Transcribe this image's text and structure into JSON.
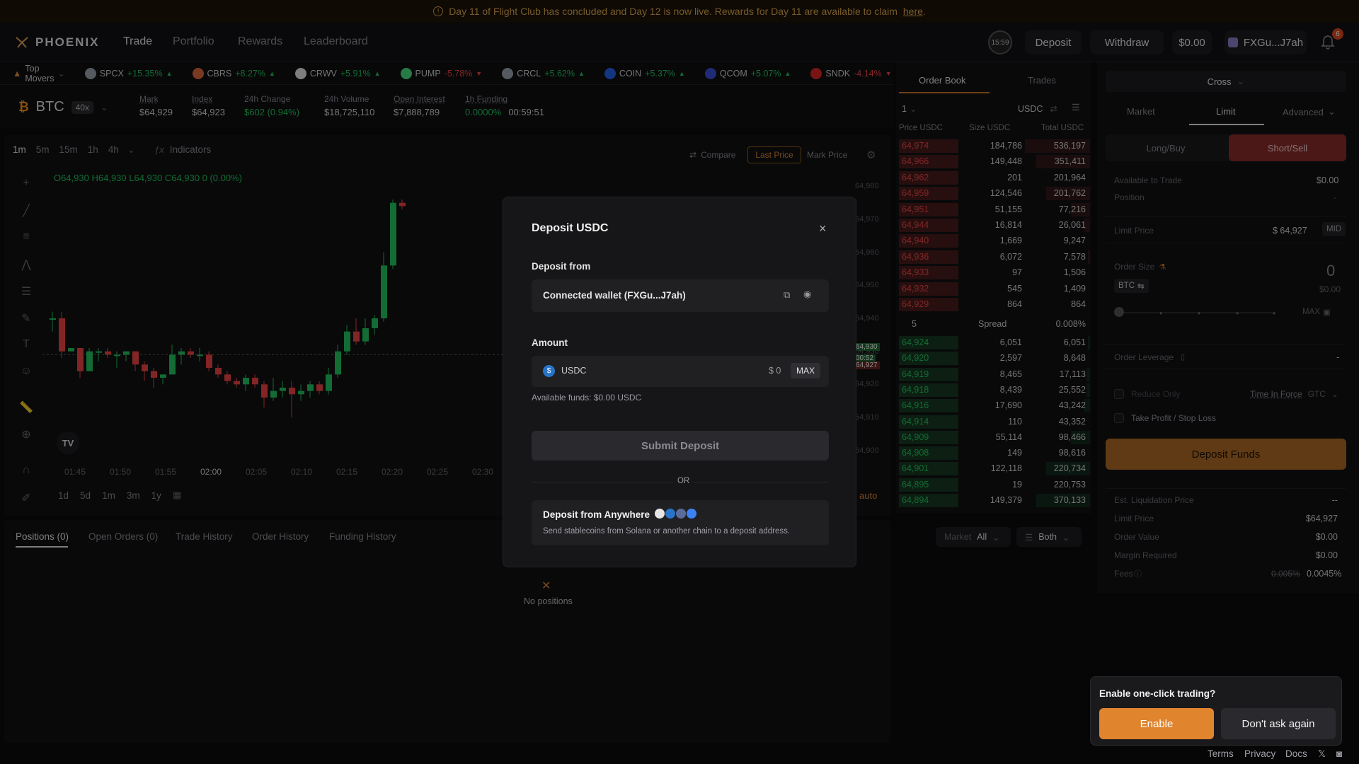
{
  "banner": {
    "text": "Day 11 of Flight Club has concluded and Day 12 is now live. Rewards for Day 11 are available to claim",
    "link": "here",
    "end": "."
  },
  "nav": {
    "logo": "PHOENIX",
    "links": [
      "Trade",
      "Portfolio",
      "Rewards",
      "Leaderboard"
    ],
    "timer": "15:59",
    "deposit": "Deposit",
    "withdraw": "Withdraw",
    "balance": "$0.00",
    "wallet": "FXGu...J7ah",
    "notif_count": "6"
  },
  "ticker": {
    "label": "Top Movers",
    "items": [
      {
        "sym": "SPCX",
        "chg": "+15.35%",
        "dir": "up",
        "color": "#9ca3af"
      },
      {
        "sym": "CBRS",
        "chg": "+8.27%",
        "dir": "up",
        "color": "#dc6b3c"
      },
      {
        "sym": "CRWV",
        "chg": "+5.91%",
        "dir": "up",
        "color": "#e5e5e5"
      },
      {
        "sym": "PUMP",
        "chg": "-5.78%",
        "dir": "down",
        "color": "#4ade80"
      },
      {
        "sym": "CRCL",
        "chg": "+5.62%",
        "dir": "up",
        "color": "#9ca3af"
      },
      {
        "sym": "COIN",
        "chg": "+5.37%",
        "dir": "up",
        "color": "#2563eb"
      },
      {
        "sym": "QCOM",
        "chg": "+5.07%",
        "dir": "up",
        "color": "#3b4fd8"
      },
      {
        "sym": "SNDK",
        "chg": "-4.14%",
        "dir": "down",
        "color": "#dc2626"
      }
    ]
  },
  "market": {
    "symbol": "BTC",
    "leverage": "40x",
    "stats": [
      {
        "label": "Mark",
        "value": "$64,929",
        "underline": true
      },
      {
        "label": "Index",
        "value": "$64,923",
        "underline": true
      },
      {
        "label": "24h Change",
        "value": "$602 (0.94%)",
        "underline": false,
        "green": true
      },
      {
        "label": "24h Volume",
        "value": "$18,725,110",
        "underline": false
      },
      {
        "label": "Open Interest",
        "value": "$7,888,789",
        "underline": true
      },
      {
        "label": "1h Funding",
        "value": "0.0000%",
        "value2": "00:59:51",
        "underline": true
      }
    ]
  },
  "chart": {
    "timeframes": [
      "1m",
      "5m",
      "15m",
      "1h",
      "4h"
    ],
    "indicators": "Indicators",
    "compare": "Compare",
    "last_price": "Last Price",
    "mark_price": "Mark Price",
    "ohlc": "O64,930 H64,930 L64,930 C64,930 0 (0.00%)",
    "y_ticks": [
      "64,980",
      "64,970",
      "64,960",
      "64,950",
      "64,940",
      "64,930",
      "64,920",
      "64,910",
      "64,900"
    ],
    "price_tags": [
      "64,930",
      "00:52",
      "64,927"
    ],
    "x_ticks": [
      "01:45",
      "01:50",
      "01:55",
      "02:00",
      "02:05",
      "02:10",
      "02:15",
      "02:20",
      "02:25",
      "02:30"
    ],
    "ranges": [
      "1d",
      "5d",
      "1m",
      "3m",
      "1y"
    ],
    "auto": "auto"
  },
  "chart_data": {
    "type": "candlestick",
    "x": [
      "01:45",
      "01:50",
      "01:55",
      "02:00",
      "02:05",
      "02:10",
      "02:15",
      "02:20",
      "02:25",
      "02:30"
    ],
    "ylim": [
      64895,
      64985
    ],
    "candles": [
      [
        64940,
        64942,
        64936,
        64940
      ],
      [
        64940,
        64942,
        64928,
        64930
      ],
      [
        64930,
        64931,
        64930,
        64931
      ],
      [
        64931,
        64931,
        64922,
        64924
      ],
      [
        64924,
        64931,
        64924,
        64930
      ],
      [
        64930,
        64931,
        64927,
        64930
      ],
      [
        64930,
        64931,
        64928,
        64929
      ],
      [
        64929,
        64930,
        64925,
        64929
      ],
      [
        64929,
        64930,
        64927,
        64930
      ],
      [
        64930,
        64930,
        64924,
        64926
      ],
      [
        64926,
        64927,
        64921,
        64924
      ],
      [
        64924,
        64925,
        64919,
        64922
      ],
      [
        64922,
        64923,
        64920,
        64923
      ],
      [
        64923,
        64932,
        64923,
        64929
      ],
      [
        64929,
        64931,
        64926,
        64930
      ],
      [
        64930,
        64931,
        64928,
        64929
      ],
      [
        64929,
        64931,
        64927,
        64929
      ],
      [
        64929,
        64930,
        64924,
        64925
      ],
      [
        64925,
        64926,
        64922,
        64923
      ],
      [
        64923,
        64924,
        64920,
        64921
      ],
      [
        64921,
        64922,
        64919,
        64920
      ],
      [
        64920,
        64923,
        64918,
        64922
      ],
      [
        64922,
        64923,
        64919,
        64920
      ],
      [
        64920,
        64921,
        64913,
        64916
      ],
      [
        64916,
        64922,
        64915,
        64918
      ],
      [
        64918,
        64921,
        64916,
        64919
      ],
      [
        64919,
        64921,
        64910,
        64917
      ],
      [
        64917,
        64920,
        64915,
        64918
      ],
      [
        64918,
        64921,
        64916,
        64920
      ],
      [
        64920,
        64921,
        64917,
        64918
      ],
      [
        64918,
        64925,
        64917,
        64923
      ],
      [
        64923,
        64932,
        64922,
        64930
      ],
      [
        64930,
        64938,
        64929,
        64936
      ],
      [
        64936,
        64940,
        64932,
        64933
      ],
      [
        64933,
        64940,
        64932,
        64937
      ],
      [
        64937,
        64941,
        64935,
        64940
      ],
      [
        64940,
        64960,
        64939,
        64956
      ],
      [
        64956,
        64976,
        64955,
        64975
      ],
      [
        64975,
        64976,
        64973,
        64974
      ]
    ]
  },
  "bottom": {
    "tabs": [
      "Positions (0)",
      "Open Orders (0)",
      "Trade History",
      "Order History",
      "Funding History"
    ],
    "market_label": "Market",
    "market_value": "All",
    "side": "Both",
    "empty": "No positions"
  },
  "orderbook": {
    "tabs": [
      "Order Book",
      "Trades"
    ],
    "grouping": "1",
    "unit": "USDC",
    "headers": [
      "Price USDC",
      "Size USDC",
      "Total USDC"
    ],
    "asks": [
      [
        "64,974",
        "184,786",
        "536,197",
        0.34
      ],
      [
        "64,966",
        "149,448",
        "351,411",
        0.28
      ],
      [
        "64,962",
        "201",
        "201,964",
        0.0
      ],
      [
        "64,959",
        "124,546",
        "201,762",
        0.23
      ],
      [
        "64,951",
        "51,155",
        "77,216",
        0.1
      ],
      [
        "64,944",
        "16,814",
        "26,061",
        0.03
      ],
      [
        "64,940",
        "1,669",
        "9,247",
        0.0
      ],
      [
        "64,936",
        "6,072",
        "7,578",
        0.01
      ],
      [
        "64,933",
        "97",
        "1,506",
        0.0
      ],
      [
        "64,932",
        "545",
        "1,409",
        0.0
      ],
      [
        "64,929",
        "864",
        "864",
        0.0
      ]
    ],
    "spread": {
      "val": "5",
      "label": "Spread",
      "pct": "0.008%"
    },
    "bids": [
      [
        "64,924",
        "6,051",
        "6,051",
        0.01
      ],
      [
        "64,920",
        "2,597",
        "8,648",
        0.0
      ],
      [
        "64,919",
        "8,465",
        "17,113",
        0.02
      ],
      [
        "64,918",
        "8,439",
        "25,552",
        0.02
      ],
      [
        "64,916",
        "17,690",
        "43,242",
        0.03
      ],
      [
        "64,914",
        "110",
        "43,352",
        0.0
      ],
      [
        "64,909",
        "55,114",
        "98,466",
        0.1
      ],
      [
        "64,908",
        "149",
        "98,616",
        0.0
      ],
      [
        "64,901",
        "122,118",
        "220,734",
        0.23
      ],
      [
        "64,895",
        "19",
        "220,753",
        0.0
      ],
      [
        "64,894",
        "149,379",
        "370,133",
        0.28
      ]
    ]
  },
  "trade": {
    "margin": "Cross",
    "tabs": [
      "Market",
      "Limit",
      "Advanced"
    ],
    "long": "Long/Buy",
    "short": "Short/Sell",
    "available_label": "Available to Trade",
    "available_value": "$0.00",
    "position_label": "Position",
    "position_value": "-",
    "limit_label": "Limit Price",
    "limit_value": "$ 64,927",
    "mid": "MID",
    "size_label": "Order Size",
    "size_value": "0",
    "size_usd": "$0.00",
    "size_unit": "BTC",
    "max": "MAX",
    "leverage_label": "Order Leverage",
    "leverage_value": "-",
    "reduce_only": "Reduce Only",
    "tif_label": "Time In Force",
    "tif_value": "GTC",
    "tpsl": "Take Profit / Stop Loss",
    "cta": "Deposit Funds",
    "summary": [
      {
        "label": "Est. Liquidation Price",
        "value": "--"
      },
      {
        "label": "Limit Price",
        "value": "$64,927"
      },
      {
        "label": "Order Value",
        "value": "$0.00"
      },
      {
        "label": "Margin Required",
        "value": "$0.00"
      }
    ],
    "fees_label": "Fees",
    "fees_old": "0.005%",
    "fees_new": "0.0045%"
  },
  "modal": {
    "title": "Deposit USDC",
    "from_label": "Deposit from",
    "from_value": "Connected wallet (FXGu...J7ah)",
    "amount_label": "Amount",
    "token": "USDC",
    "amount_value": "$ 0",
    "max": "MAX",
    "available": "Available funds: $0.00 USDC",
    "submit": "Submit Deposit",
    "or": "OR",
    "anywhere_title": "Deposit from Anywhere",
    "anywhere_desc": "Send stablecoins from Solana or another chain to a deposit address."
  },
  "toast": {
    "title": "Enable one-click trading?",
    "enable": "Enable",
    "dismiss": "Don't ask again"
  },
  "footer": {
    "links": [
      "Terms",
      "Privacy",
      "Docs"
    ]
  },
  "colors": {
    "accent": "#c9772b",
    "green": "#22c55e",
    "red": "#ef4444"
  }
}
